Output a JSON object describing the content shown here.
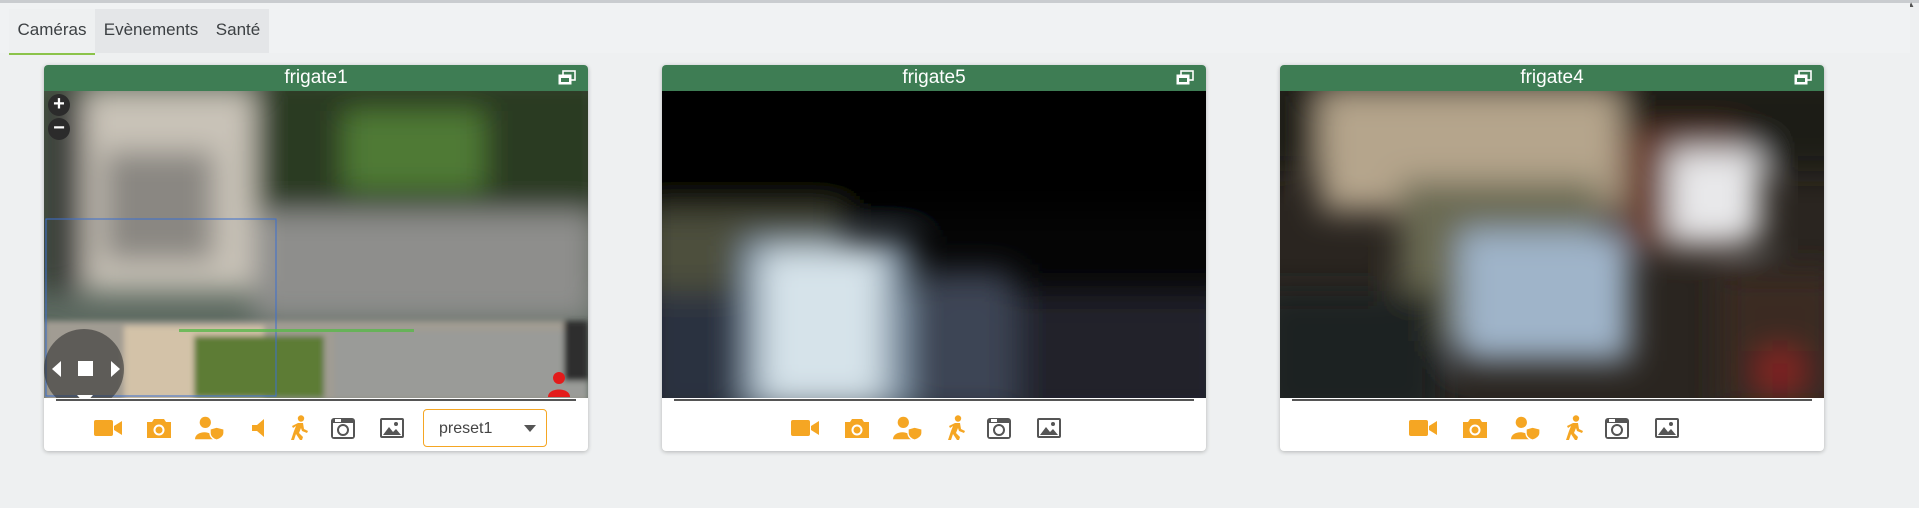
{
  "tabs": [
    {
      "label": "Caméras",
      "active": true
    },
    {
      "label": "Evènements",
      "active": false
    },
    {
      "label": "Santé",
      "active": false
    }
  ],
  "cameras": [
    {
      "name": "frigate1",
      "has_ptz": true,
      "preset": "preset1",
      "person_detected": true
    },
    {
      "name": "frigate5",
      "has_ptz": false
    },
    {
      "name": "frigate4",
      "has_ptz": false
    }
  ],
  "colors": {
    "header": "#3e7d54",
    "accent": "#f5a623",
    "alert": "#e31b1b",
    "active_tab_underline": "#8bc34a"
  },
  "toolbar_icons": [
    "video-record-icon",
    "snapshot-camera-icon",
    "user-shield-icon",
    "speaker-icon",
    "motion-person-icon",
    "recordings-icon",
    "gallery-icon"
  ]
}
